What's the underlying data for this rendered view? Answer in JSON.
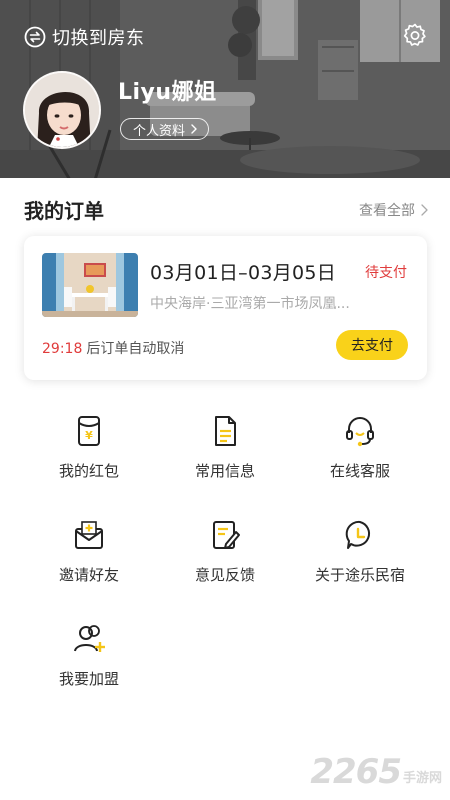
{
  "colors": {
    "accent": "#f9d21a",
    "alert": "#e03c3c",
    "muted": "#888888",
    "icon_dark": "#222222",
    "icon_accent": "#f5c518"
  },
  "header": {
    "switch_label": "切换到房东",
    "switch_icon": "swap-arrows-icon",
    "settings_icon": "gear-icon",
    "user_name": "Liyu娜姐",
    "profile_label": "个人资料"
  },
  "orders": {
    "title": "我的订单",
    "view_all": "查看全部",
    "card": {
      "dates": "03月01日–03月05日",
      "status": "待支付",
      "address": "中央海岸·三亚湾第一市场凤凰...",
      "countdown": "29:18",
      "cancel_text": "后订单自动取消",
      "pay_label": "去支付"
    }
  },
  "menu": [
    {
      "label": "我的红包",
      "icon": "red-packet-icon"
    },
    {
      "label": "常用信息",
      "icon": "document-icon"
    },
    {
      "label": "在线客服",
      "icon": "headset-icon"
    },
    {
      "label": "邀请好友",
      "icon": "invite-envelope-icon"
    },
    {
      "label": "意见反馈",
      "icon": "feedback-edit-icon"
    },
    {
      "label": "关于途乐民宿",
      "icon": "about-clock-icon"
    },
    {
      "label": "我要加盟",
      "icon": "join-users-icon"
    }
  ],
  "watermark": {
    "number": "2265",
    "text": "手游网"
  }
}
